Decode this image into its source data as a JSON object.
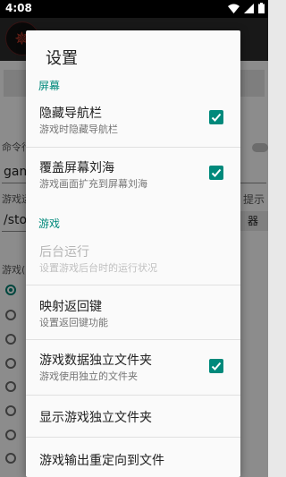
{
  "status_bar": {
    "time": "4:08"
  },
  "background": {
    "label_cmd": "命令行",
    "input_1": "gam",
    "label_path": "游戏运",
    "tip": "提示",
    "input_2": "/sto",
    "button": "器",
    "label_mode": "游戏("
  },
  "dialog": {
    "title": "设置",
    "sections": [
      {
        "header": "屏幕"
      },
      {
        "header": "游戏"
      }
    ],
    "items": [
      {
        "title": "隐藏导航栏",
        "summary": "游戏时隐藏导航栏",
        "checked": true,
        "enabled": true
      },
      {
        "title": "覆盖屏幕刘海",
        "summary": "游戏画面扩充到屏幕刘海",
        "checked": true,
        "enabled": true
      },
      {
        "title": "后台运行",
        "summary": "设置游戏后台时的运行状况",
        "enabled": false
      },
      {
        "title": "映射返回键",
        "summary": "设置返回键功能",
        "enabled": true
      },
      {
        "title": "游戏数据独立文件夹",
        "summary": "游戏使用独立的文件夹",
        "checked": true,
        "enabled": true
      },
      {
        "title": "显示游戏独立文件夹",
        "enabled": true
      },
      {
        "title": "游戏输出重定向到文件",
        "enabled": true
      }
    ]
  },
  "colors": {
    "accent": "#00897b",
    "status_bar": "#000000",
    "app_bar": "#2a2a2a"
  }
}
